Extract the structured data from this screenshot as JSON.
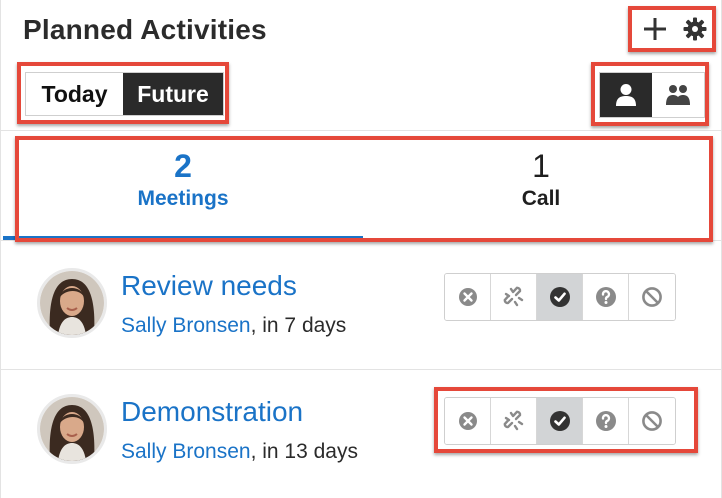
{
  "header": {
    "title": "Planned Activities",
    "add_icon": "plus-icon",
    "settings_icon": "gear-icon"
  },
  "filter": {
    "today_label": "Today",
    "future_label": "Future",
    "selected": "Future"
  },
  "view": {
    "my_icon": "single-user-icon",
    "team_icon": "group-users-icon",
    "selected": "my"
  },
  "tabs": [
    {
      "count": "2",
      "label": "Meetings",
      "active": true
    },
    {
      "count": "1",
      "label": "Call",
      "active": false
    }
  ],
  "meetings": [
    {
      "title": "Review needs",
      "person": "Sally Bronsen",
      "when": ", in 7 days",
      "status": "held"
    },
    {
      "title": "Demonstration",
      "person": "Sally Bronsen",
      "when": ", in 13 days",
      "status": "held"
    }
  ],
  "status_icons": [
    "remove-icon",
    "unlink-icon",
    "held-check-icon",
    "tentative-question-icon",
    "decline-ban-icon"
  ],
  "colors": {
    "accent": "#1a73c7",
    "highlight": "#e5483a",
    "dark_button": "#2a2a2a",
    "status_selected": "#d2d4d6"
  }
}
